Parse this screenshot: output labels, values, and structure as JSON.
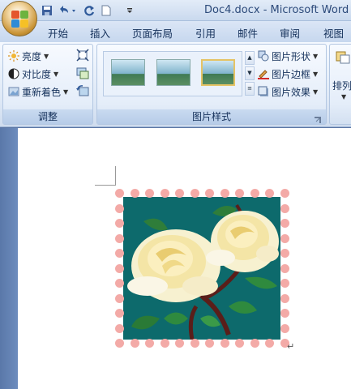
{
  "window": {
    "title": "Doc4.docx - Microsoft Word"
  },
  "quick_access": {
    "icons": [
      "save-icon",
      "undo-icon",
      "redo-icon",
      "new-document-icon",
      "customize-dropdown-icon"
    ]
  },
  "tabs": [
    "开始",
    "插入",
    "页面布局",
    "引用",
    "邮件",
    "审阅",
    "视图"
  ],
  "ribbon": {
    "adjust": {
      "label": "调整",
      "brightness": "亮度",
      "contrast": "对比度",
      "recolor": "重新着色"
    },
    "picture_styles": {
      "label": "图片样式",
      "shape": "图片形状",
      "border": "图片边框",
      "effects": "图片效果"
    },
    "arrange": {
      "label": "排列"
    }
  },
  "document": {
    "paragraph_mark": "↵"
  }
}
